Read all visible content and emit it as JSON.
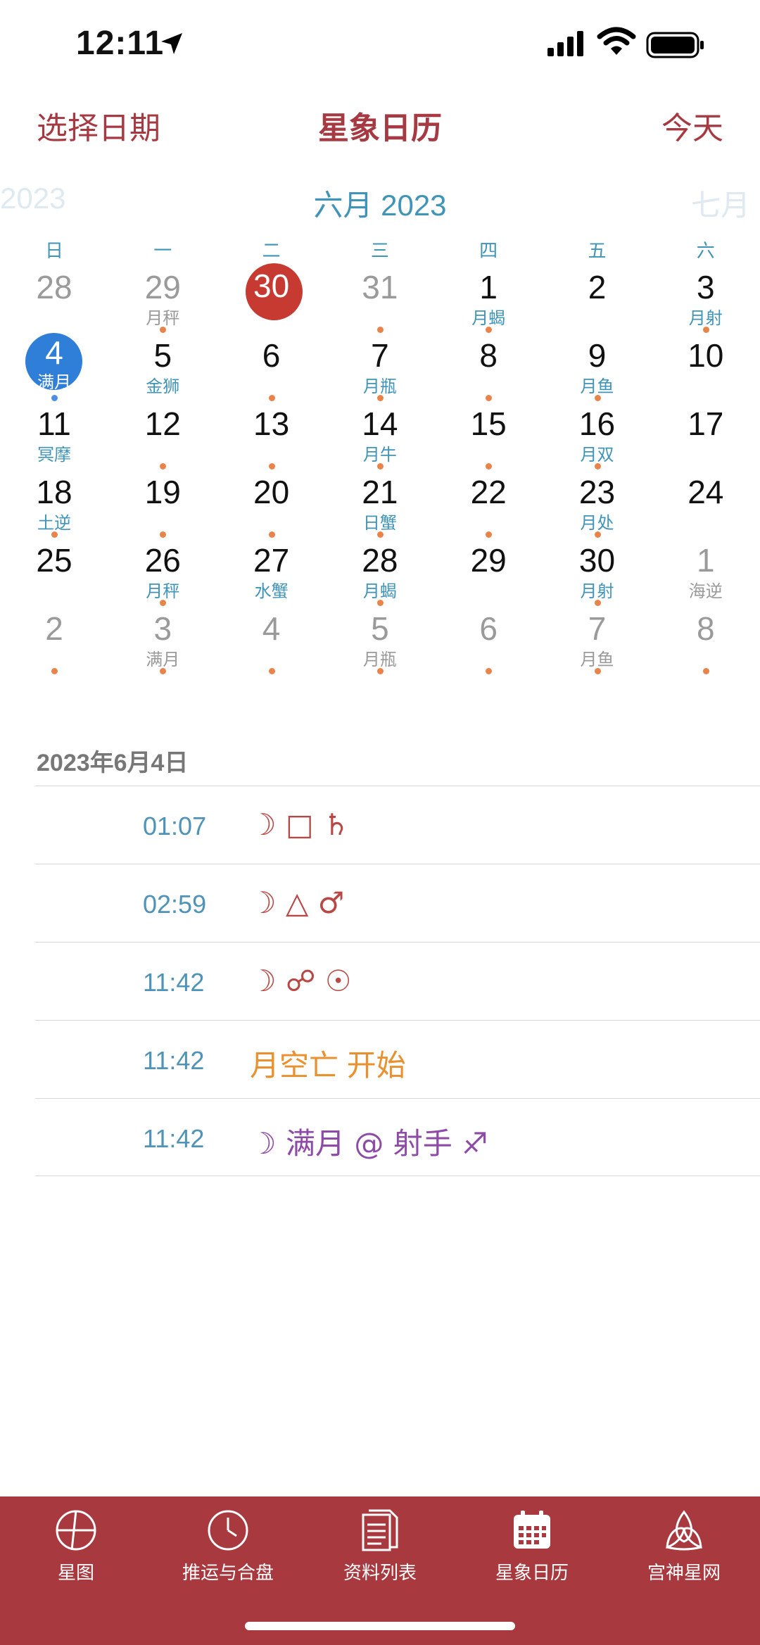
{
  "status_bar": {
    "time": "12:11"
  },
  "nav": {
    "select_date": "选择日期",
    "title": "星象日历",
    "today": "今天"
  },
  "month_header": {
    "prev": "2023",
    "current": "六月 2023",
    "next": "七月"
  },
  "weekdays": [
    "日",
    "一",
    "二",
    "三",
    "四",
    "五",
    "六"
  ],
  "calendar": {
    "weeks": [
      [
        {
          "d": "28",
          "s": "",
          "o": true,
          "dot": false
        },
        {
          "d": "29",
          "s": "月秤",
          "o": true,
          "dot": true
        },
        {
          "d": "30",
          "s": "",
          "o": true,
          "dot": false,
          "today": true
        },
        {
          "d": "31",
          "s": "",
          "o": true,
          "dot": true
        },
        {
          "d": "1",
          "s": "月蝎",
          "o": false,
          "dot": true
        },
        {
          "d": "2",
          "s": "",
          "o": false,
          "dot": false
        },
        {
          "d": "3",
          "s": "月射",
          "o": false,
          "dot": true
        }
      ],
      [
        {
          "d": "4",
          "s": "满月",
          "o": false,
          "dot": true,
          "selected": true
        },
        {
          "d": "5",
          "s": "金狮",
          "o": false,
          "dot": false
        },
        {
          "d": "6",
          "s": "",
          "o": false,
          "dot": true
        },
        {
          "d": "7",
          "s": "月瓶",
          "o": false,
          "dot": true
        },
        {
          "d": "8",
          "s": "",
          "o": false,
          "dot": true
        },
        {
          "d": "9",
          "s": "月鱼",
          "o": false,
          "dot": true
        },
        {
          "d": "10",
          "s": "",
          "o": false,
          "dot": false
        }
      ],
      [
        {
          "d": "11",
          "s": "冥摩",
          "o": false,
          "dot": false
        },
        {
          "d": "12",
          "s": "",
          "o": false,
          "dot": true
        },
        {
          "d": "13",
          "s": "",
          "o": false,
          "dot": true
        },
        {
          "d": "14",
          "s": "月牛",
          "o": false,
          "dot": true
        },
        {
          "d": "15",
          "s": "",
          "o": false,
          "dot": true
        },
        {
          "d": "16",
          "s": "月双",
          "o": false,
          "dot": true
        },
        {
          "d": "17",
          "s": "",
          "o": false,
          "dot": false
        }
      ],
      [
        {
          "d": "18",
          "s": "土逆",
          "o": false,
          "dot": true
        },
        {
          "d": "19",
          "s": "",
          "o": false,
          "dot": true
        },
        {
          "d": "20",
          "s": "",
          "o": false,
          "dot": true
        },
        {
          "d": "21",
          "s": "日蟹",
          "o": false,
          "dot": true
        },
        {
          "d": "22",
          "s": "",
          "o": false,
          "dot": true
        },
        {
          "d": "23",
          "s": "月处",
          "o": false,
          "dot": true
        },
        {
          "d": "24",
          "s": "",
          "o": false,
          "dot": false
        }
      ],
      [
        {
          "d": "25",
          "s": "",
          "o": false,
          "dot": false
        },
        {
          "d": "26",
          "s": "月秤",
          "o": false,
          "dot": true
        },
        {
          "d": "27",
          "s": "水蟹",
          "o": false,
          "dot": false
        },
        {
          "d": "28",
          "s": "月蝎",
          "o": false,
          "dot": true
        },
        {
          "d": "29",
          "s": "",
          "o": false,
          "dot": false
        },
        {
          "d": "30",
          "s": "月射",
          "o": false,
          "dot": true
        },
        {
          "d": "1",
          "s": "海逆",
          "o": true,
          "dot": false
        }
      ],
      [
        {
          "d": "2",
          "s": "",
          "o": true,
          "dot": true
        },
        {
          "d": "3",
          "s": "满月",
          "o": true,
          "dot": true
        },
        {
          "d": "4",
          "s": "",
          "o": true,
          "dot": true
        },
        {
          "d": "5",
          "s": "月瓶",
          "o": true,
          "dot": true
        },
        {
          "d": "6",
          "s": "",
          "o": true,
          "dot": true
        },
        {
          "d": "7",
          "s": "月鱼",
          "o": true,
          "dot": true
        },
        {
          "d": "8",
          "s": "",
          "o": true,
          "dot": true
        }
      ]
    ]
  },
  "events": {
    "date": "2023年6月4日",
    "items": [
      {
        "time": "01:07",
        "desc": "☽ □ ♄",
        "style": "red"
      },
      {
        "time": "02:59",
        "desc": "☽ △ ♂",
        "style": "red"
      },
      {
        "time": "11:42",
        "desc": "☽ ☍ ☉",
        "style": "red"
      },
      {
        "time": "11:42",
        "desc": "月空亡 开始",
        "style": "orange"
      },
      {
        "time": "11:42",
        "desc": "☽ 满月 @ 射手 ♐",
        "style": "purple"
      }
    ]
  },
  "tabs": [
    {
      "label": "星图",
      "icon": "chart-wheel-icon"
    },
    {
      "label": "推运与合盘",
      "icon": "clock-icon"
    },
    {
      "label": "资料列表",
      "icon": "document-list-icon"
    },
    {
      "label": "星象日历",
      "icon": "calendar-icon"
    },
    {
      "label": "宫神星网",
      "icon": "triquetra-icon"
    }
  ]
}
